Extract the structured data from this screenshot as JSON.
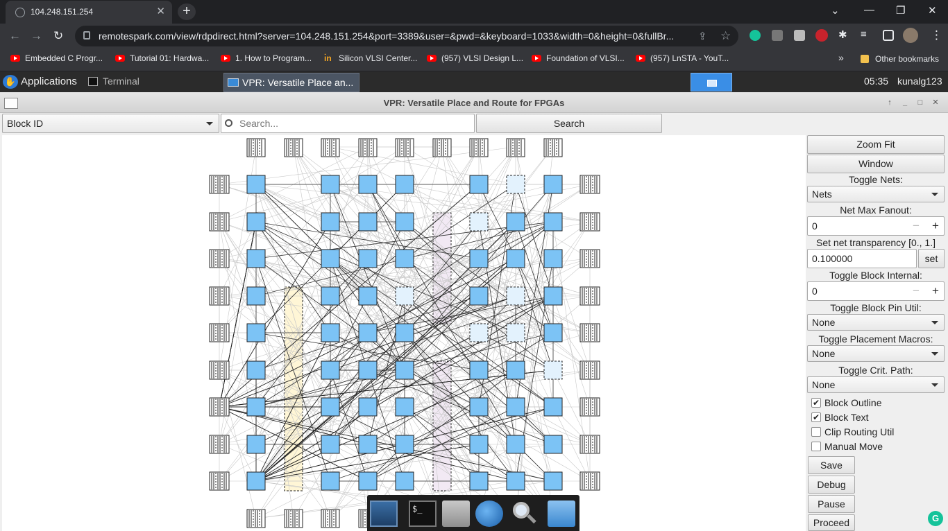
{
  "browser": {
    "tab_title": "104.248.151.254",
    "new_tab": "+",
    "tab_close": "✕",
    "url": "remotespark.com/view/rdpdirect.html?server=104.248.151.254&port=3389&user=&pwd=&keyboard=1033&width=0&height=0&fullBr...",
    "bookmarks": [
      {
        "label": "Embedded C Progr...",
        "icon": "youtube-icon"
      },
      {
        "label": "Tutorial 01: Hardwa...",
        "icon": "youtube-icon"
      },
      {
        "label": "1. How to Program...",
        "icon": "youtube-icon"
      },
      {
        "label": "Silicon VLSI Center...",
        "icon": "site-icon"
      },
      {
        "label": "(957) VLSI Design L...",
        "icon": "youtube-icon"
      },
      {
        "label": "Foundation of VLSI...",
        "icon": "youtube-icon"
      },
      {
        "label": "(957) LnSTA - YouT...",
        "icon": "youtube-icon"
      }
    ],
    "bookmarks_more": "»",
    "other_bookmarks": "Other bookmarks"
  },
  "desktop": {
    "applications": "Applications",
    "terminal": "Terminal",
    "active_window": "VPR: Versatile Place an...",
    "clock": "05:35",
    "user": "kunalg123"
  },
  "vpr": {
    "title": "VPR: Versatile Place and Route for FPGAs",
    "search_type": "Block ID",
    "search_placeholder": "Search...",
    "search_button": "Search",
    "zoom_fit": "Zoom Fit",
    "window": "Window",
    "toggle_nets_label": "Toggle Nets:",
    "toggle_nets_value": "Nets",
    "net_max_fanout_label": "Net Max Fanout:",
    "net_max_fanout_value": "0",
    "transparency_label": "Set net transparency [0., 1.]",
    "transparency_value": "0.100000",
    "set_button": "set",
    "block_internal_label": "Toggle Block Internal:",
    "block_internal_value": "0",
    "block_pin_util_label": "Toggle Block Pin Util:",
    "block_pin_util_value": "None",
    "placement_macros_label": "Toggle Placement Macros:",
    "placement_macros_value": "None",
    "crit_path_label": "Toggle Crit. Path:",
    "crit_path_value": "None",
    "minus": "−",
    "plus": "+",
    "checkboxes": [
      {
        "label": "Block Outline",
        "checked": true
      },
      {
        "label": "Block Text",
        "checked": true
      },
      {
        "label": "Clip Routing Util",
        "checked": false
      },
      {
        "label": "Manual Move",
        "checked": false
      }
    ],
    "save": "Save",
    "debug": "Debug",
    "pause": "Pause",
    "proceed": "Proceed"
  },
  "colors": {
    "clb_fill": "#7cc3f5",
    "clb_empty": "#e3f2fd",
    "ram_column": "#fff6d6",
    "dsp_column": "#f2e9f4"
  }
}
